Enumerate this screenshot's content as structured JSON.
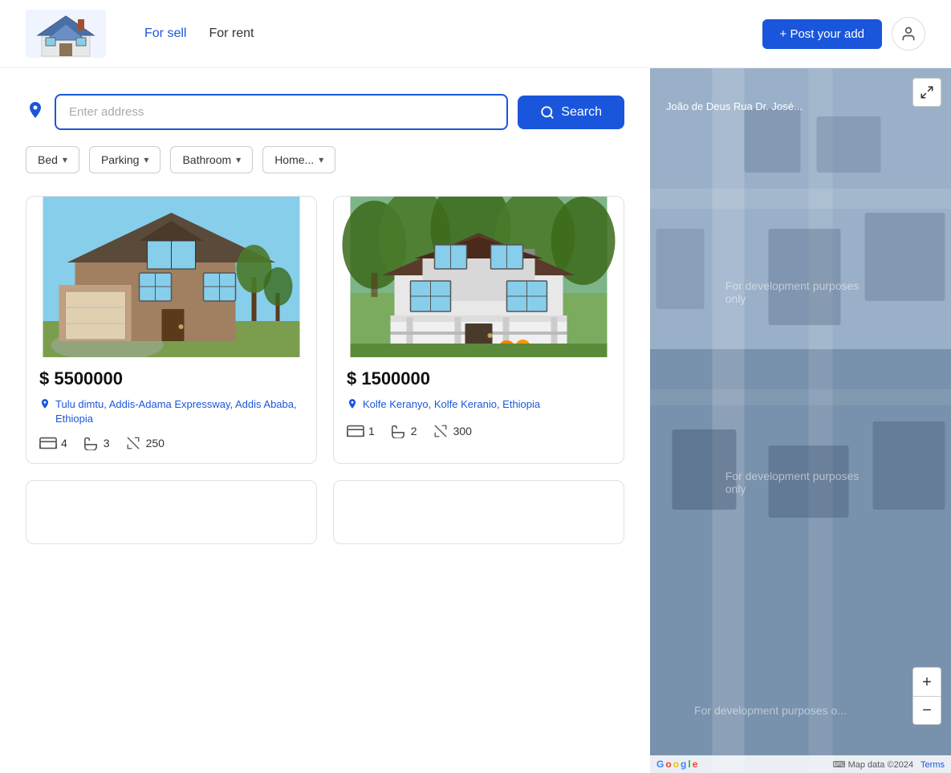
{
  "header": {
    "nav": [
      {
        "label": "For sell",
        "active": true
      },
      {
        "label": "For rent",
        "active": false
      }
    ],
    "post_button": "+ Post your add",
    "post_button_icon": "plus"
  },
  "search": {
    "placeholder": "Enter address",
    "button_label": "Search",
    "location_icon": "📍"
  },
  "filters": [
    {
      "label": "Bed",
      "id": "bed-filter"
    },
    {
      "label": "Parking",
      "id": "parking-filter"
    },
    {
      "label": "Bathroom",
      "id": "bathroom-filter"
    },
    {
      "label": "Home...",
      "id": "home-filter"
    }
  ],
  "listings": [
    {
      "price": "$ 5500000",
      "location": "Tulu dimtu, Addis-Adama Expressway, Addis Ababa, Ethiopia",
      "beds": "4",
      "baths": "3",
      "area": "250",
      "image_alt": "Stone house with garage"
    },
    {
      "price": "$ 1500000",
      "location": "Kolfe Keranyo, Kolfe Keranio, Ethiopia",
      "beds": "1",
      "baths": "2",
      "area": "300",
      "image_alt": "White house with porch"
    }
  ],
  "map": {
    "road_text": "João de Deus    Rua Dr. José...",
    "dev_text_1": "For development purposes only",
    "dev_text_2": "For development purposes only",
    "dev_text_3": "For development purposes o...",
    "map_data": "Map data ©2024",
    "terms": "Terms",
    "zoom_in": "+",
    "zoom_out": "−",
    "fullscreen_icon": "⛶"
  }
}
